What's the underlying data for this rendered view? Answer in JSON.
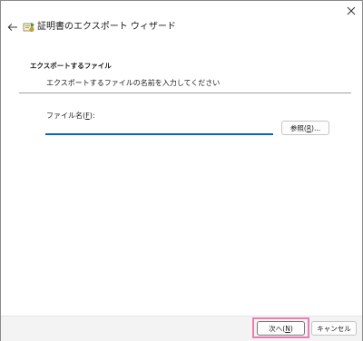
{
  "window": {
    "title": "証明書のエクスポート ウィザード"
  },
  "icons": {
    "close": "close-icon",
    "back": "back-arrow-icon",
    "title": "certificate-icon"
  },
  "section": {
    "heading": "エクスポートするファイル",
    "description": "エクスポートするファイルの名前を入力してください"
  },
  "filename": {
    "label_main": "ファイル名(",
    "label_accel": "F",
    "label_end": "):",
    "value": "",
    "placeholder": ""
  },
  "browse_button": {
    "label_main": "参照(",
    "label_accel": "R",
    "label_end": ")..."
  },
  "footer": {
    "next": {
      "label_main": "次へ(",
      "label_accel": "N",
      "label_end": ")"
    },
    "cancel": "キャンセル"
  },
  "colors": {
    "accent": "#0067c0",
    "highlight": "#e87fb3"
  }
}
